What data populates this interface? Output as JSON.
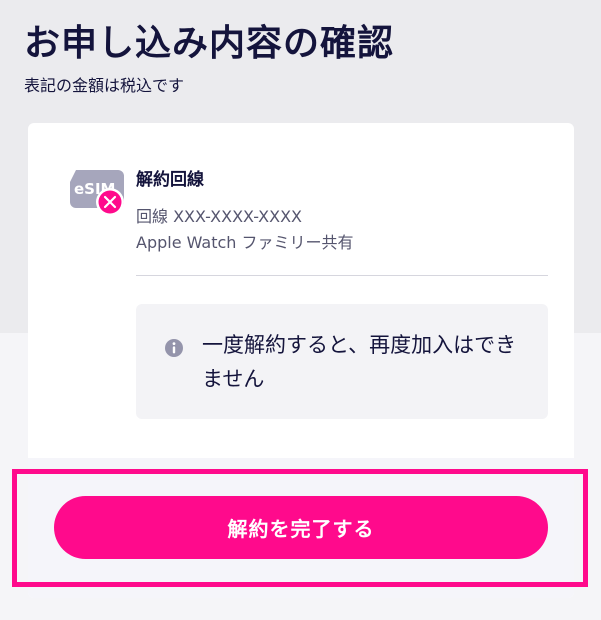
{
  "header": {
    "title": "お申し込み内容の確認",
    "subtitle": "表記の金額は税込です"
  },
  "line": {
    "icon": "esim-cancel-icon",
    "icon_text": "eSIM",
    "heading": "解約回線",
    "number": "回線 XXX-XXXX-XXXX",
    "plan": "Apple Watch ファミリー共有"
  },
  "notice": {
    "icon": "info-icon",
    "text": "一度解約すると、再度加入はできません"
  },
  "action": {
    "complete_label": "解約を完了する"
  },
  "colors": {
    "accent": "#ff0a8c",
    "text_dark": "#14143c",
    "text_muted": "#55556e"
  }
}
